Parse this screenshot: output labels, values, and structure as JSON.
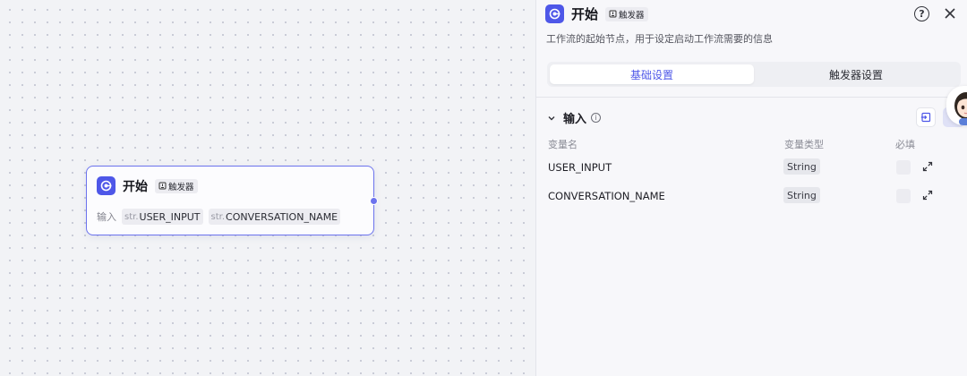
{
  "node": {
    "title": "开始",
    "trigger_tag": "触发器",
    "inputs_label": "输入",
    "inputs": [
      {
        "type": "str.",
        "name": "USER_INPUT"
      },
      {
        "type": "str.",
        "name": "CONVERSATION_NAME"
      }
    ]
  },
  "panel": {
    "title": "开始",
    "trigger_tag": "触发器",
    "description": "工作流的起始节点，用于设定启动工作流需要的信息",
    "tabs": [
      {
        "label": "基础设置",
        "active": true
      },
      {
        "label": "触发器设置",
        "active": false
      }
    ],
    "section_title": "输入",
    "columns": {
      "name": "变量名",
      "type": "变量类型",
      "required": "必填"
    },
    "rows": [
      {
        "name": "USER_INPUT",
        "type": "String"
      },
      {
        "name": "CONVERSATION_NAME",
        "type": "String"
      }
    ]
  },
  "colors": {
    "accent": "#4e57e8",
    "node_border": "#6c73ee"
  },
  "icons": [
    "start-app-icon",
    "trigger-icon",
    "help-icon",
    "close-icon",
    "chevron-down-icon",
    "info-icon",
    "import-icon",
    "add-icon",
    "expand-icon"
  ]
}
